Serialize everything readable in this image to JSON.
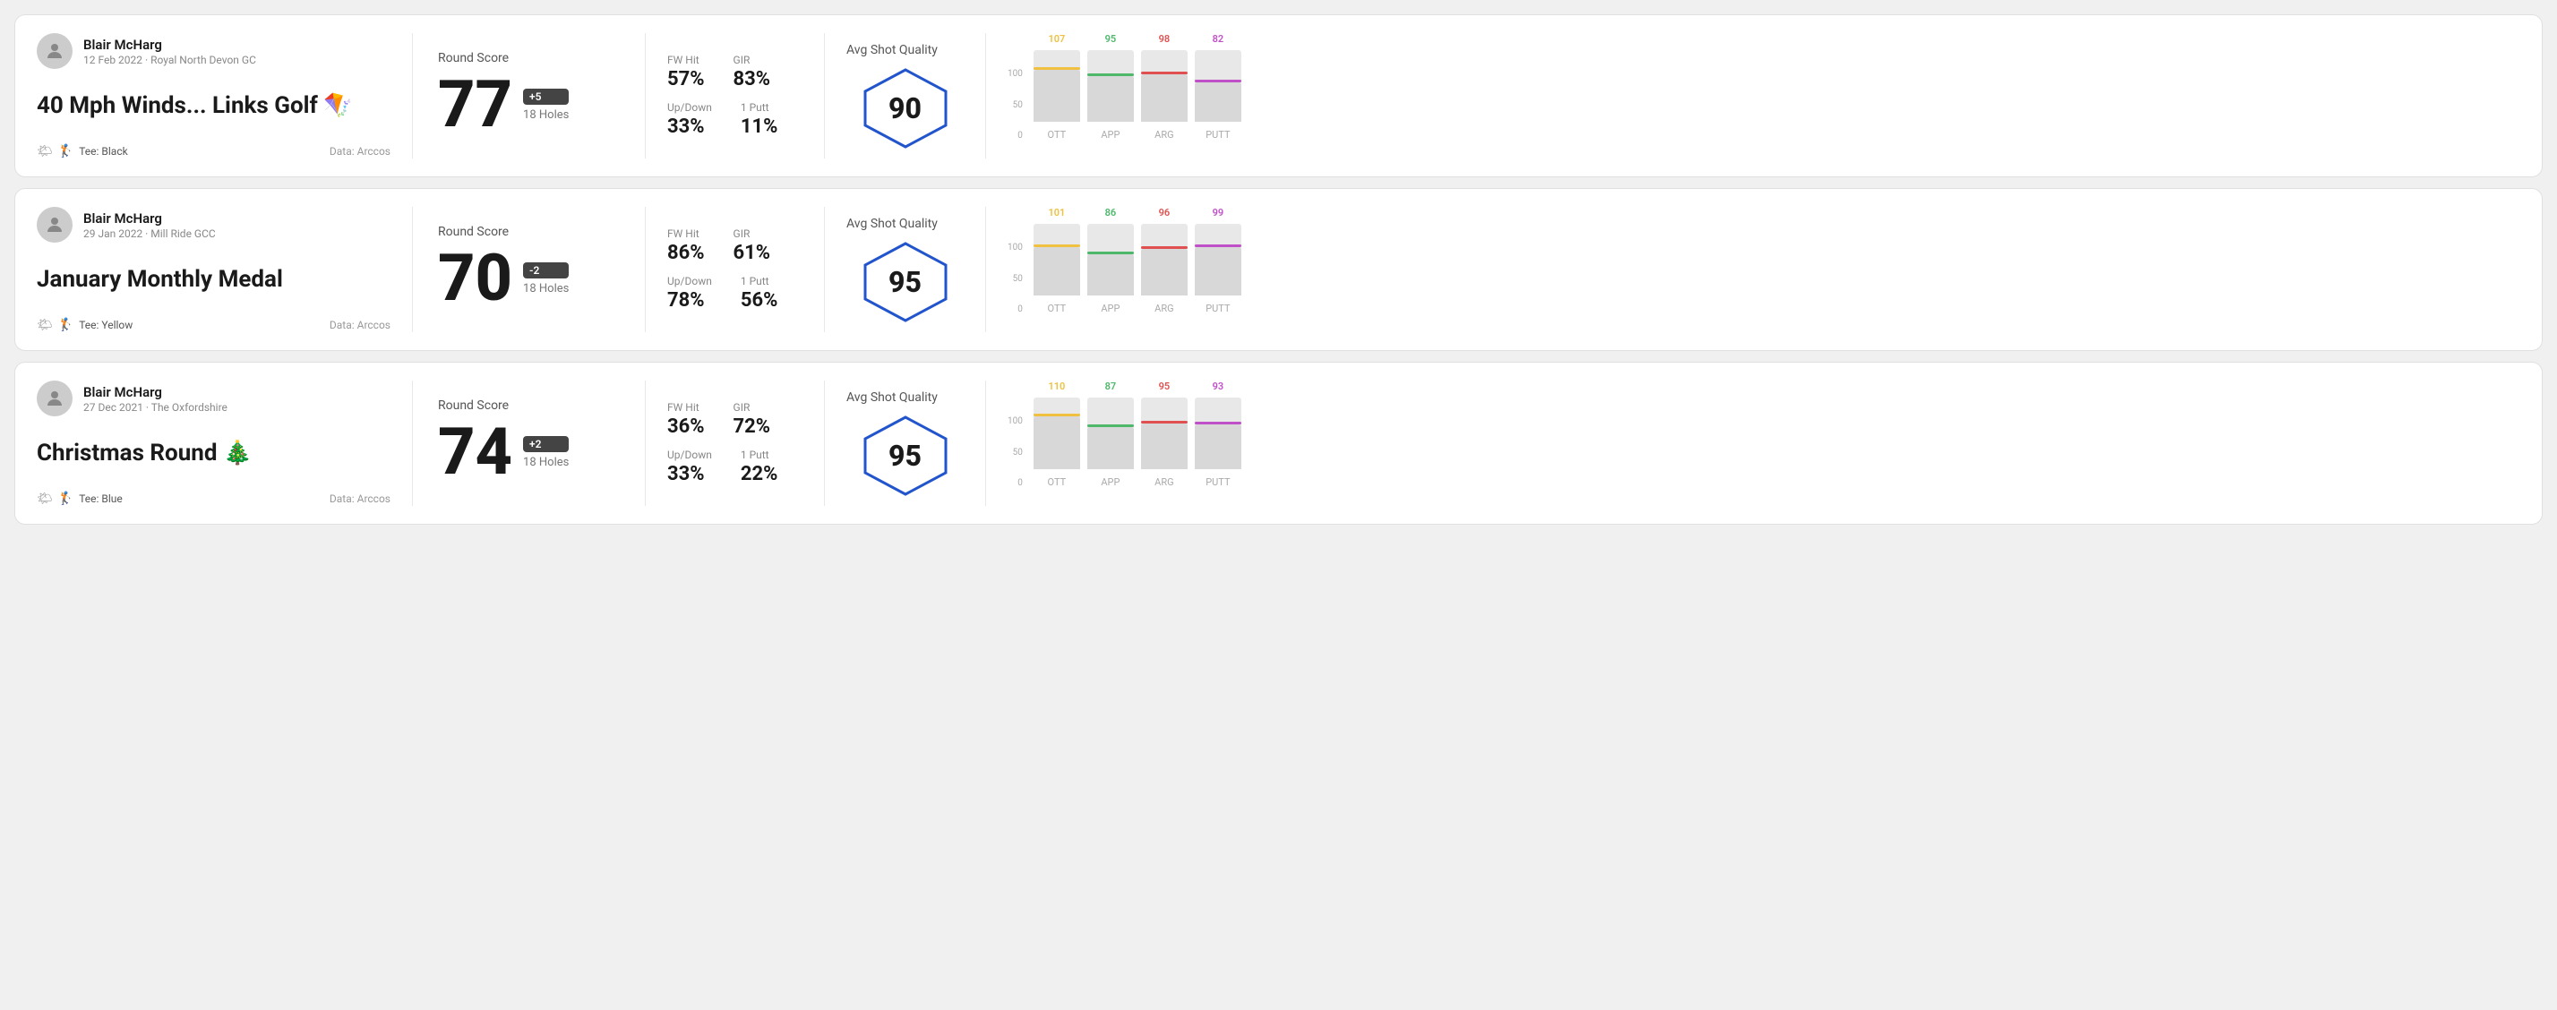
{
  "rounds": [
    {
      "id": "round-1",
      "user": {
        "name": "Blair McHarg",
        "date_course": "12 Feb 2022 · Royal North Devon GC"
      },
      "title": "40 Mph Winds... Links Golf 🪁",
      "tee": "Black",
      "data_source": "Data: Arccos",
      "score": {
        "value": "77",
        "badge": "+5",
        "holes": "18 Holes"
      },
      "stats": {
        "fw_hit_label": "FW Hit",
        "fw_hit_value": "57%",
        "gir_label": "GIR",
        "gir_value": "83%",
        "up_down_label": "Up/Down",
        "up_down_value": "33%",
        "one_putt_label": "1 Putt",
        "one_putt_value": "11%"
      },
      "quality": {
        "label": "Avg Shot Quality",
        "score": "90"
      },
      "chart": {
        "bars": [
          {
            "label": "OTT",
            "value": 107,
            "color": "#f0c040",
            "height_pct": 72
          },
          {
            "label": "APP",
            "value": 95,
            "color": "#4db86a",
            "height_pct": 64
          },
          {
            "label": "ARG",
            "value": 98,
            "color": "#e05050",
            "height_pct": 66
          },
          {
            "label": "PUTT",
            "value": 82,
            "color": "#c050c8",
            "height_pct": 55
          }
        ],
        "y_labels": [
          "100",
          "50",
          "0"
        ]
      }
    },
    {
      "id": "round-2",
      "user": {
        "name": "Blair McHarg",
        "date_course": "29 Jan 2022 · Mill Ride GCC"
      },
      "title": "January Monthly Medal",
      "tee": "Yellow",
      "data_source": "Data: Arccos",
      "score": {
        "value": "70",
        "badge": "-2",
        "holes": "18 Holes"
      },
      "stats": {
        "fw_hit_label": "FW Hit",
        "fw_hit_value": "86%",
        "gir_label": "GIR",
        "gir_value": "61%",
        "up_down_label": "Up/Down",
        "up_down_value": "78%",
        "one_putt_label": "1 Putt",
        "one_putt_value": "56%"
      },
      "quality": {
        "label": "Avg Shot Quality",
        "score": "95"
      },
      "chart": {
        "bars": [
          {
            "label": "OTT",
            "value": 101,
            "color": "#f0c040",
            "height_pct": 68
          },
          {
            "label": "APP",
            "value": 86,
            "color": "#4db86a",
            "height_pct": 58
          },
          {
            "label": "ARG",
            "value": 96,
            "color": "#e05050",
            "height_pct": 65
          },
          {
            "label": "PUTT",
            "value": 99,
            "color": "#c050c8",
            "height_pct": 67
          }
        ],
        "y_labels": [
          "100",
          "50",
          "0"
        ]
      }
    },
    {
      "id": "round-3",
      "user": {
        "name": "Blair McHarg",
        "date_course": "27 Dec 2021 · The Oxfordshire"
      },
      "title": "Christmas Round 🎄",
      "tee": "Blue",
      "data_source": "Data: Arccos",
      "score": {
        "value": "74",
        "badge": "+2",
        "holes": "18 Holes"
      },
      "stats": {
        "fw_hit_label": "FW Hit",
        "fw_hit_value": "36%",
        "gir_label": "GIR",
        "gir_value": "72%",
        "up_down_label": "Up/Down",
        "up_down_value": "33%",
        "one_putt_label": "1 Putt",
        "one_putt_value": "22%"
      },
      "quality": {
        "label": "Avg Shot Quality",
        "score": "95"
      },
      "chart": {
        "bars": [
          {
            "label": "OTT",
            "value": 110,
            "color": "#f0c040",
            "height_pct": 74
          },
          {
            "label": "APP",
            "value": 87,
            "color": "#4db86a",
            "height_pct": 59
          },
          {
            "label": "ARG",
            "value": 95,
            "color": "#e05050",
            "height_pct": 64
          },
          {
            "label": "PUTT",
            "value": 93,
            "color": "#c050c8",
            "height_pct": 63
          }
        ],
        "y_labels": [
          "100",
          "50",
          "0"
        ]
      }
    }
  ],
  "labels": {
    "round_score": "Round Score",
    "avg_shot_quality": "Avg Shot Quality",
    "data_prefix": "Data:",
    "tee_prefix": "Tee:"
  }
}
